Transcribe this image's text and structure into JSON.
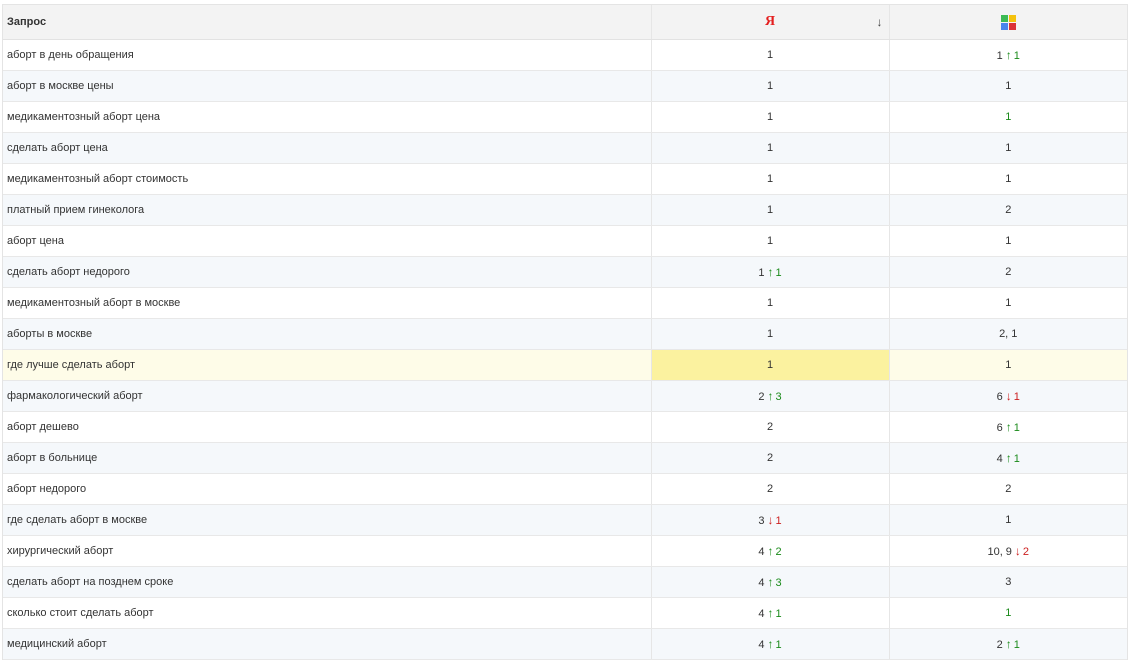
{
  "header": {
    "query_label": "Запрос",
    "yandex_icon": "Я",
    "sort_icon": "↓",
    "google_icon": "google-icon"
  },
  "colors": {
    "up": "#1a8a1a",
    "down": "#cc1f1f",
    "highlight": "#fbf29f"
  },
  "rows": [
    {
      "query": "аборт в день обращения",
      "y": {
        "pos": "1"
      },
      "g": {
        "pos": "1",
        "dir": "up",
        "delta": "1"
      }
    },
    {
      "query": "аборт в москве цены",
      "y": {
        "pos": "1"
      },
      "g": {
        "pos": "1"
      }
    },
    {
      "query": "медикаментозный аборт цена",
      "y": {
        "pos": "1"
      },
      "g": {
        "pos": "1",
        "green": true
      }
    },
    {
      "query": "сделать аборт цена",
      "y": {
        "pos": "1"
      },
      "g": {
        "pos": "1"
      }
    },
    {
      "query": "медикаментозный аборт стоимость",
      "y": {
        "pos": "1"
      },
      "g": {
        "pos": "1"
      }
    },
    {
      "query": "платный прием гинеколога",
      "y": {
        "pos": "1"
      },
      "g": {
        "pos": "2"
      }
    },
    {
      "query": "аборт цена",
      "y": {
        "pos": "1"
      },
      "g": {
        "pos": "1"
      }
    },
    {
      "query": "сделать аборт недорого",
      "y": {
        "pos": "1",
        "dir": "up",
        "delta": "1"
      },
      "g": {
        "pos": "2"
      }
    },
    {
      "query": "медикаментозный аборт в москве",
      "y": {
        "pos": "1"
      },
      "g": {
        "pos": "1"
      }
    },
    {
      "query": "аборты в москве",
      "y": {
        "pos": "1"
      },
      "g": {
        "pos": "2, 1"
      }
    },
    {
      "query": "где лучше сделать аборт",
      "y": {
        "pos": "1"
      },
      "g": {
        "pos": "1"
      },
      "highlight": true
    },
    {
      "query": "фармакологический аборт",
      "y": {
        "pos": "2",
        "dir": "up",
        "delta": "3"
      },
      "g": {
        "pos": "6",
        "dir": "down",
        "delta": "1"
      }
    },
    {
      "query": "аборт дешево",
      "y": {
        "pos": "2"
      },
      "g": {
        "pos": "6",
        "dir": "up",
        "delta": "1"
      }
    },
    {
      "query": "аборт в больнице",
      "y": {
        "pos": "2"
      },
      "g": {
        "pos": "4",
        "dir": "up",
        "delta": "1"
      }
    },
    {
      "query": "аборт недорого",
      "y": {
        "pos": "2"
      },
      "g": {
        "pos": "2"
      }
    },
    {
      "query": "где сделать аборт в москве",
      "y": {
        "pos": "3",
        "dir": "down",
        "delta": "1"
      },
      "g": {
        "pos": "1"
      }
    },
    {
      "query": "хирургический аборт",
      "y": {
        "pos": "4",
        "dir": "up",
        "delta": "2"
      },
      "g": {
        "pos": "10, 9",
        "dir": "down",
        "delta": "2"
      }
    },
    {
      "query": "сделать аборт на позднем сроке",
      "y": {
        "pos": "4",
        "dir": "up",
        "delta": "3"
      },
      "g": {
        "pos": "3"
      }
    },
    {
      "query": "сколько стоит сделать аборт",
      "y": {
        "pos": "4",
        "dir": "up",
        "delta": "1"
      },
      "g": {
        "pos": "1",
        "green": true
      }
    },
    {
      "query": "медицинский аборт",
      "y": {
        "pos": "4",
        "dir": "up",
        "delta": "1"
      },
      "g": {
        "pos": "2",
        "dir": "up",
        "delta": "1"
      }
    }
  ]
}
